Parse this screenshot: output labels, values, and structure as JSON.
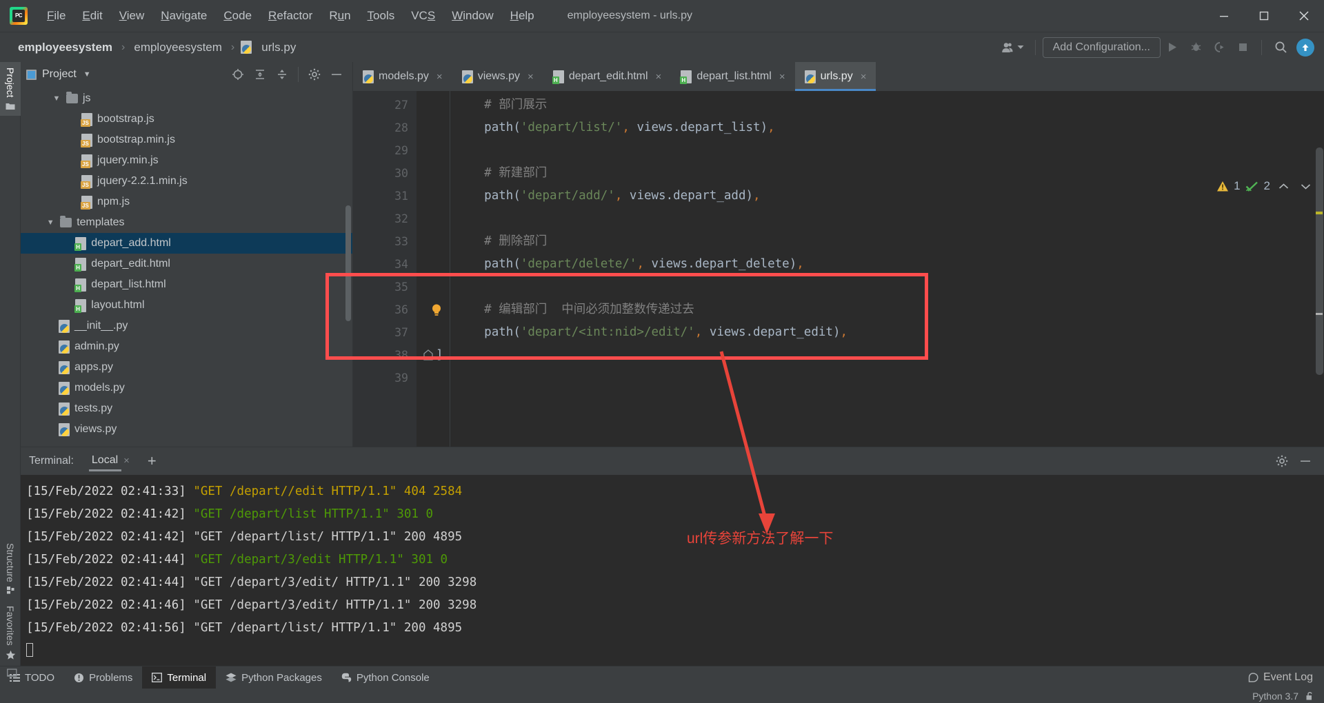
{
  "titlebar": {
    "logo_text": "PC",
    "window_title": "employeesystem - urls.py",
    "menus": [
      {
        "pre": "",
        "mn": "F",
        "post": "ile"
      },
      {
        "pre": "",
        "mn": "E",
        "post": "dit"
      },
      {
        "pre": "",
        "mn": "V",
        "post": "iew"
      },
      {
        "pre": "",
        "mn": "N",
        "post": "avigate"
      },
      {
        "pre": "",
        "mn": "C",
        "post": "ode"
      },
      {
        "pre": "",
        "mn": "R",
        "post": "efactor"
      },
      {
        "pre": "R",
        "mn": "u",
        "post": "n"
      },
      {
        "pre": "",
        "mn": "T",
        "post": "ools"
      },
      {
        "pre": "VC",
        "mn": "S",
        "post": ""
      },
      {
        "pre": "",
        "mn": "W",
        "post": "indow"
      },
      {
        "pre": "",
        "mn": "H",
        "post": "elp"
      }
    ],
    "controls": {
      "minimize": "minimize-icon",
      "maximize": "maximize-icon",
      "close": "close-icon"
    }
  },
  "navbar": {
    "breadcrumbs": [
      "employeesystem",
      "employeesystem",
      "urls.py"
    ],
    "separator": "›",
    "user_icon": "user-accounts-icon",
    "add_configuration_label": "Add Configuration...",
    "run_icon": "run-icon",
    "debug_icon": "debug-icon",
    "coverage_icon": "run-with-coverage-icon",
    "stop_icon": "stop-icon",
    "search_icon": "search-everywhere-icon",
    "update_icon": "update-project-icon"
  },
  "left_rail": {
    "top": [
      {
        "label": "Project",
        "icon": "project-folder-icon",
        "active": true
      }
    ],
    "bottom": [
      {
        "label": "Structure",
        "icon": "structure-icon",
        "active": false
      },
      {
        "label": "Favorites",
        "icon": "star-icon",
        "active": false
      }
    ]
  },
  "project_panel": {
    "title": "Project",
    "dropdown_icon": "chevron-down-icon",
    "head_icons": [
      "select-opened-file-icon",
      "expand-all-icon",
      "collapse-all-icon",
      "gear-icon",
      "hide-icon"
    ],
    "tree": [
      {
        "label": "js",
        "type": "folder",
        "indent": 2,
        "expanded": true,
        "selected": false
      },
      {
        "label": "bootstrap.js",
        "type": "js",
        "indent": 4,
        "selected": false
      },
      {
        "label": "bootstrap.min.js",
        "type": "js",
        "indent": 4,
        "selected": false
      },
      {
        "label": "jquery.min.js",
        "type": "js",
        "indent": 4,
        "selected": false
      },
      {
        "label": "jquery-2.2.1.min.js",
        "type": "js",
        "indent": 4,
        "selected": false
      },
      {
        "label": "npm.js",
        "type": "js",
        "indent": 4,
        "selected": false
      },
      {
        "label": "templates",
        "type": "folder",
        "indent": 1.6,
        "expanded": true,
        "selected": false
      },
      {
        "label": "depart_add.html",
        "type": "html",
        "indent": 3.6,
        "selected": true
      },
      {
        "label": "depart_edit.html",
        "type": "html",
        "indent": 3.6,
        "selected": false
      },
      {
        "label": "depart_list.html",
        "type": "html",
        "indent": 3.6,
        "selected": false
      },
      {
        "label": "layout.html",
        "type": "html",
        "indent": 3.6,
        "selected": false
      },
      {
        "label": "__init__.py",
        "type": "py",
        "indent": 2.5,
        "selected": false
      },
      {
        "label": "admin.py",
        "type": "py",
        "indent": 2.5,
        "selected": false
      },
      {
        "label": "apps.py",
        "type": "py",
        "indent": 2.5,
        "selected": false
      },
      {
        "label": "models.py",
        "type": "py",
        "indent": 2.5,
        "selected": false
      },
      {
        "label": "tests.py",
        "type": "py",
        "indent": 2.5,
        "selected": false
      },
      {
        "label": "views.py",
        "type": "py",
        "indent": 2.5,
        "selected": false
      }
    ]
  },
  "editor": {
    "tabs": [
      {
        "label": "models.py",
        "type": "py",
        "active": false
      },
      {
        "label": "views.py",
        "type": "py",
        "active": false
      },
      {
        "label": "depart_edit.html",
        "type": "html",
        "active": false
      },
      {
        "label": "depart_list.html",
        "type": "html",
        "active": false
      },
      {
        "label": "urls.py",
        "type": "py",
        "active": true
      }
    ],
    "close_glyph": "×",
    "inspection": {
      "warning_icon": "warning-triangle-icon",
      "warning_count": "1",
      "ok_icon": "inspection-ok-icon",
      "ok_count": "2",
      "prev_icon": "chevron-up-icon",
      "next_icon": "chevron-down-icon"
    },
    "bulb_icon": "intention-bulb-icon",
    "fold_icon": "fold-block-icon",
    "lines": [
      {
        "no": "27",
        "segments": [
          {
            "t": "    ",
            "c": "plain"
          },
          {
            "t": "# 部门展示",
            "c": "com"
          }
        ]
      },
      {
        "no": "28",
        "segments": [
          {
            "t": "    ",
            "c": "plain"
          },
          {
            "t": "path",
            "c": "plain"
          },
          {
            "t": "(",
            "c": "plain"
          },
          {
            "t": "'depart/list/'",
            "c": "str"
          },
          {
            "t": ",",
            "c": "punct"
          },
          {
            "t": " views.depart_list",
            "c": "plain"
          },
          {
            "t": ")",
            "c": "plain"
          },
          {
            "t": ",",
            "c": "punct"
          }
        ]
      },
      {
        "no": "29",
        "segments": []
      },
      {
        "no": "30",
        "segments": [
          {
            "t": "    ",
            "c": "plain"
          },
          {
            "t": "# 新建部门",
            "c": "com"
          }
        ]
      },
      {
        "no": "31",
        "segments": [
          {
            "t": "    ",
            "c": "plain"
          },
          {
            "t": "path",
            "c": "plain"
          },
          {
            "t": "(",
            "c": "plain"
          },
          {
            "t": "'depart/add/'",
            "c": "str"
          },
          {
            "t": ",",
            "c": "punct"
          },
          {
            "t": " views.depart_add",
            "c": "plain"
          },
          {
            "t": ")",
            "c": "plain"
          },
          {
            "t": ",",
            "c": "punct"
          }
        ]
      },
      {
        "no": "32",
        "segments": []
      },
      {
        "no": "33",
        "segments": [
          {
            "t": "    ",
            "c": "plain"
          },
          {
            "t": "# 删除部门",
            "c": "com"
          }
        ]
      },
      {
        "no": "34",
        "segments": [
          {
            "t": "    ",
            "c": "plain"
          },
          {
            "t": "path",
            "c": "plain"
          },
          {
            "t": "(",
            "c": "plain"
          },
          {
            "t": "'depart/delete/'",
            "c": "str"
          },
          {
            "t": ",",
            "c": "punct"
          },
          {
            "t": " views.depart_delete",
            "c": "plain"
          },
          {
            "t": ")",
            "c": "plain"
          },
          {
            "t": ",",
            "c": "punct"
          }
        ]
      },
      {
        "no": "35",
        "segments": []
      },
      {
        "no": "36",
        "segments": [
          {
            "t": "    ",
            "c": "plain"
          },
          {
            "t": "# 编辑部门  中间必须加整数传递过去",
            "c": "com"
          }
        ],
        "bulb": true
      },
      {
        "no": "37",
        "segments": [
          {
            "t": "    ",
            "c": "plain"
          },
          {
            "t": "path",
            "c": "plain"
          },
          {
            "t": "(",
            "c": "plain"
          },
          {
            "t": "'depart/<int:nid>/edit/'",
            "c": "str"
          },
          {
            "t": ",",
            "c": "punct"
          },
          {
            "t": " views.depart_edit",
            "c": "plain"
          },
          {
            "t": ")",
            "c": "plain"
          },
          {
            "t": ",",
            "c": "punct"
          }
        ]
      },
      {
        "no": "38",
        "segments": [
          {
            "t": "]",
            "c": "plain"
          }
        ],
        "fold": true
      },
      {
        "no": "39",
        "segments": []
      }
    ]
  },
  "terminal": {
    "label": "Terminal:",
    "tab_label": "Local",
    "close_glyph": "×",
    "add_glyph": "+",
    "settings_icon": "gear-icon",
    "hide_icon": "hide-icon",
    "lines": [
      {
        "ts": "[15/Feb/2022 02:41:33]",
        "req": "\"GET /depart//edit HTTP/1.1\" 404 2584",
        "color": "yellow"
      },
      {
        "ts": "[15/Feb/2022 02:41:42]",
        "req": "\"GET /depart/list HTTP/1.1\" 301 0",
        "color": "green"
      },
      {
        "ts": "[15/Feb/2022 02:41:42]",
        "req": "\"GET /depart/list/ HTTP/1.1\" 200 4895",
        "color": "ok"
      },
      {
        "ts": "[15/Feb/2022 02:41:44]",
        "req": "\"GET /depart/3/edit HTTP/1.1\" 301 0",
        "color": "green"
      },
      {
        "ts": "[15/Feb/2022 02:41:44]",
        "req": "\"GET /depart/3/edit/ HTTP/1.1\" 200 3298",
        "color": "ok"
      },
      {
        "ts": "[15/Feb/2022 02:41:46]",
        "req": "\"GET /depart/3/edit/ HTTP/1.1\" 200 3298",
        "color": "ok"
      },
      {
        "ts": "[15/Feb/2022 02:41:56]",
        "req": "\"GET /depart/list/ HTTP/1.1\" 200 4895",
        "color": "ok"
      }
    ]
  },
  "annotation": {
    "text": "url传参新方法了解一下",
    "color": "#e8443a",
    "arrow": "red-arrow-annotation",
    "box": "red-highlight-box"
  },
  "bottom_bar": {
    "items": [
      {
        "label": "TODO",
        "icon": "todo-list-icon",
        "active": false
      },
      {
        "label": "Problems",
        "icon": "problems-icon",
        "active": false
      },
      {
        "label": "Terminal",
        "icon": "terminal-icon",
        "active": true
      },
      {
        "label": "Python Packages",
        "icon": "packages-icon",
        "active": false
      },
      {
        "label": "Python Console",
        "icon": "python-console-icon",
        "active": false
      }
    ],
    "event_log": {
      "label": "Event Log",
      "icon": "event-log-icon"
    }
  },
  "statusbar": {
    "interpreter": "Python 3.7",
    "lock_icon": "lock-open-icon"
  },
  "colors": {
    "accent": "#3592c4",
    "annotation_red": "#e8443a",
    "selection_blue": "#0d3a58",
    "editor_bg": "#2b2b2b",
    "chrome_bg": "#3c3f41",
    "string_green": "#6a8759",
    "comment_gray": "#808080",
    "punct_orange": "#cc7832"
  }
}
